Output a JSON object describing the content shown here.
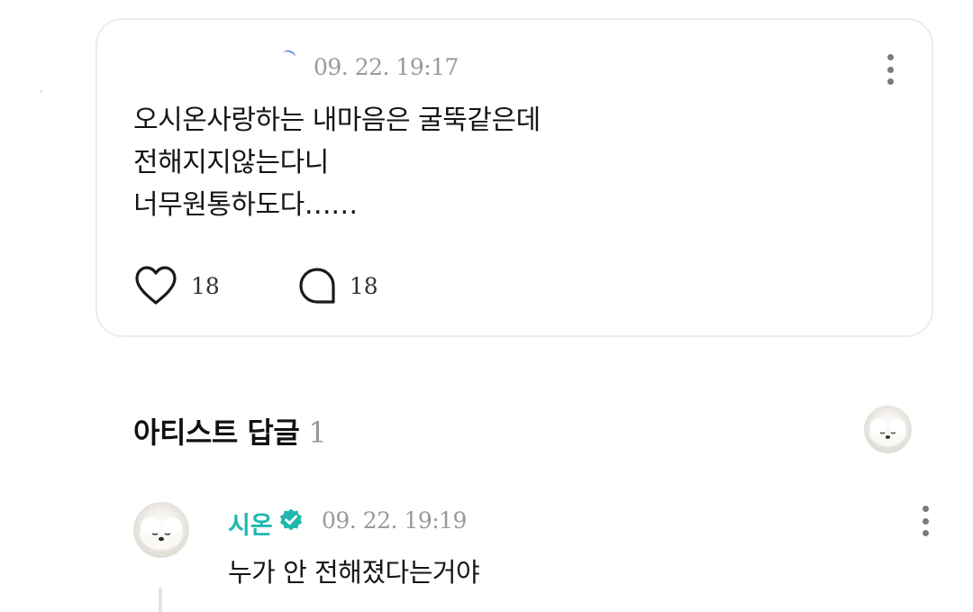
{
  "post": {
    "timestamp": "09. 22. 19:17",
    "lines": [
      "오시온사랑하는 내마음은 굴뚝같은데",
      "전해지지않는다니",
      "너무원통하도다……"
    ],
    "like_count": "18",
    "comment_count": "18"
  },
  "artist_replies": {
    "title": "아티스트 답글",
    "count": "1"
  },
  "reply": {
    "author": "시온",
    "timestamp": "09. 22. 19:19",
    "text": "누가 안 전해졌다는거야"
  },
  "colors": {
    "accent": "#20b8ad",
    "muted": "#9a9a9a",
    "border": "#ececec"
  }
}
